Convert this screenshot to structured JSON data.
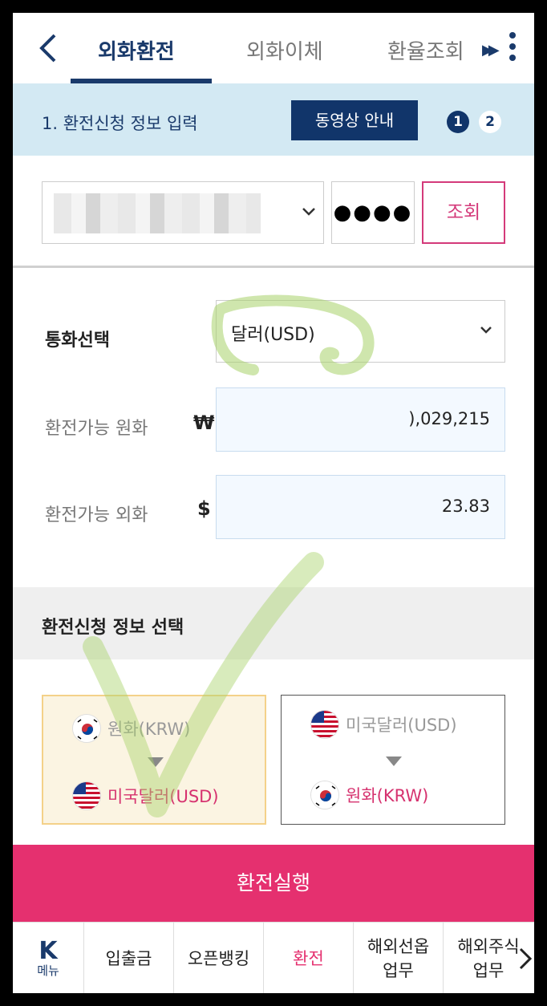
{
  "header": {
    "tabs": [
      {
        "label": "외화환전",
        "active": true
      },
      {
        "label": "외화이체",
        "active": false
      },
      {
        "label": "환율조회",
        "active": false
      }
    ],
    "accent_color": "#1a3a6b"
  },
  "step_bar": {
    "title": "1. 환전신청 정보 입력",
    "video_button": "동영상 안내",
    "steps": [
      "1",
      "2"
    ],
    "current_step": 1
  },
  "account": {
    "password_mask": "●●●●",
    "lookup_button": "조회"
  },
  "form": {
    "currency_label": "통화선택",
    "currency_value": "달러(USD)",
    "krw_label": "환전가능 원화",
    "krw_unit": "₩",
    "krw_value": "),029,215",
    "fx_label": "환전가능 외화",
    "fx_unit": "$",
    "fx_value": "23.83"
  },
  "section": {
    "title": "환전신청 정보 선택"
  },
  "options": [
    {
      "from": "원화(KRW)",
      "to": "미국달러(USD)",
      "selected": true
    },
    {
      "from": "미국달러(USD)",
      "to": "원화(KRW)",
      "selected": false
    }
  ],
  "execute_button": "환전실행",
  "bottom_nav": {
    "menu_icon": "K",
    "menu_label": "메뉴",
    "items": [
      {
        "label": "입출금",
        "active": false
      },
      {
        "label": "오픈뱅킹",
        "active": false
      },
      {
        "label": "환전",
        "active": true
      },
      {
        "label": "해외선옵\n업무",
        "active": false
      },
      {
        "label": "해외주식\n업무",
        "active": false
      }
    ]
  },
  "colors": {
    "primary_navy": "#11356a",
    "accent_pink": "#e5306f",
    "step_bar_bg": "#d3e9f3",
    "annotation_green": "#a8d26a"
  }
}
